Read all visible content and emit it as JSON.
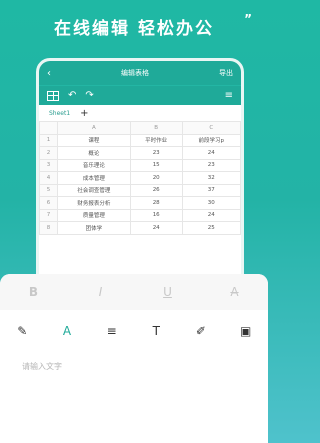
{
  "headline": {
    "text": "在线编辑 轻松办公",
    "quote_mark": "”"
  },
  "app": {
    "back": "‹",
    "title": "编辑表格",
    "export": "导出"
  },
  "toolbar": {
    "grid_icon": "table-grid-icon",
    "undo": "↶",
    "redo": "↷",
    "menu": "≡"
  },
  "sheet": {
    "tab": "Sheet1",
    "add": "+"
  },
  "table": {
    "columns": [
      "",
      "A",
      "B",
      "C"
    ],
    "rows": [
      [
        "1",
        "课程",
        "平时作业",
        "前段学习p"
      ],
      [
        "2",
        "概论",
        "23",
        "24"
      ],
      [
        "3",
        "音乐理论",
        "15",
        "23"
      ],
      [
        "4",
        "成本管理",
        "20",
        "32"
      ],
      [
        "5",
        "社会调查管理",
        "26",
        "37"
      ],
      [
        "6",
        "财务报表分析",
        "28",
        "30"
      ],
      [
        "7",
        "质量管理",
        "16",
        "24"
      ],
      [
        "8",
        "团体学",
        "24",
        "25"
      ]
    ]
  },
  "format_bar": {
    "bold": "B",
    "italic": "I",
    "underline": "U",
    "strike": "A"
  },
  "tools": {
    "edit": "✎",
    "font_color": "A",
    "align": "≡",
    "text": "T",
    "pen": "✐",
    "image": "▣"
  },
  "input": {
    "placeholder": "请输入文字"
  }
}
